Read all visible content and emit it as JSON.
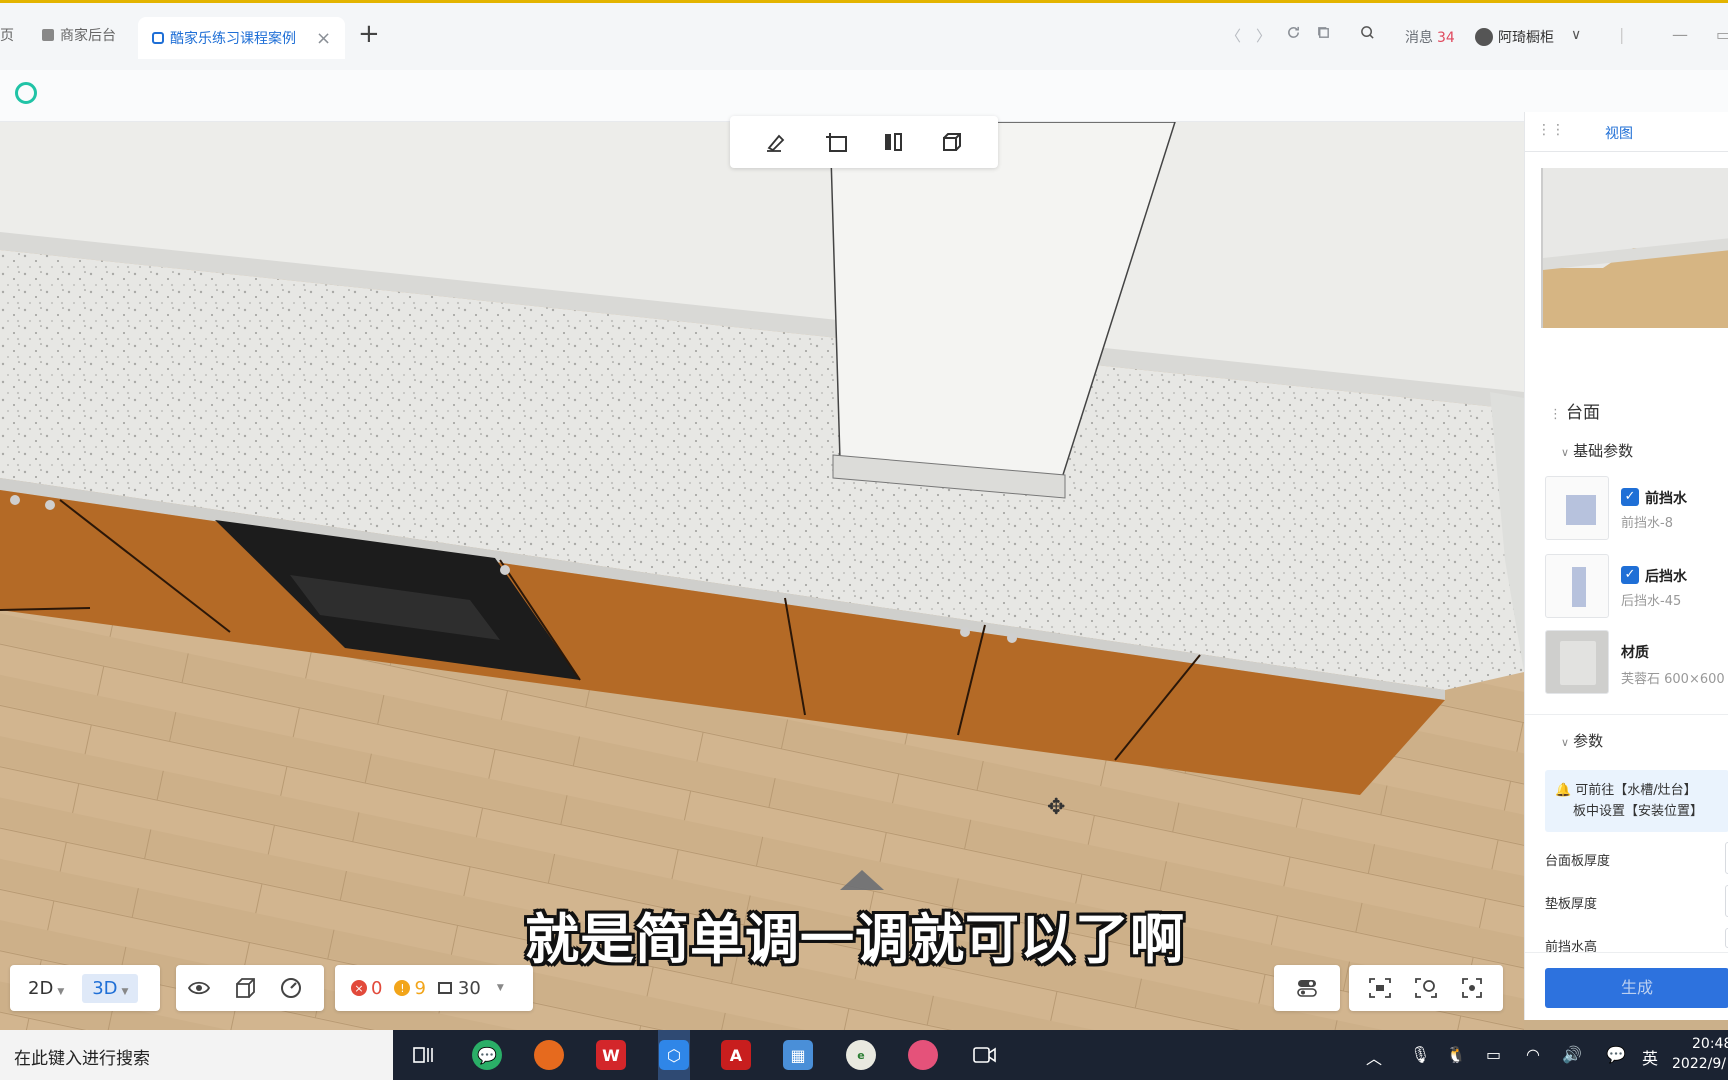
{
  "browser": {
    "tab_partial": "页",
    "tab_merchant": "商家后台",
    "tab_active": "酷家乐练习课程案例",
    "tab_close": "×",
    "new_tab": "+",
    "back": "〈",
    "forward": "〉",
    "message_label": "消息",
    "message_count": "34",
    "user_name": "阿琦橱柜",
    "user_chevron": "∨"
  },
  "subtitle": "就是简单调一调就可以了啊",
  "view_controls": {
    "mode_2d": "2D",
    "mode_3d": "3D",
    "active_mode": "3D"
  },
  "status": {
    "errors": "0",
    "warnings": "9",
    "items": "30"
  },
  "panel": {
    "tab_view": "视图",
    "section_countertop": "台面",
    "group_basic": "基础参数",
    "front_splash_label": "前挡水",
    "front_splash_value": "前挡水-8",
    "back_splash_label": "后挡水",
    "back_splash_value": "后挡水-45",
    "material_label": "材质",
    "material_value": "芙蓉石 600×600",
    "group_params": "参数",
    "notice_line1": "可前往【水槽/灶台】",
    "notice_line2": "板中设置【安装位置】",
    "param_top_thickness": "台面板厚度",
    "param_pad_thickness": "垫板厚度",
    "param_front_splash_height": "前挡水高",
    "generate_button": "生成"
  },
  "taskbar": {
    "search_placeholder": "在此键入进行搜索",
    "ime_label": "英",
    "time": "20:48",
    "date": "2022/9/"
  },
  "colors": {
    "accent": "#1f6fd6",
    "error": "#e24a3b",
    "warning": "#f2a51a",
    "cabinet": "#b46a26",
    "taskbar": "#1b2332"
  }
}
